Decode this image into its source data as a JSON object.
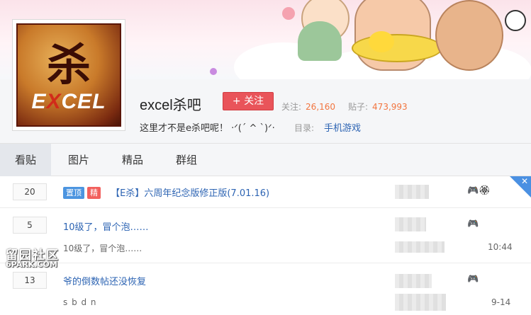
{
  "forum": {
    "name": "excel杀吧",
    "follow_label": "+ 关注",
    "followers_label": "关注:",
    "followers": "26,160",
    "posts_label": "贴子:",
    "posts": "473,993",
    "slogan": "这里才不是e杀吧呢！ ·ᐟ(´ ^ `)ᐟ·",
    "directory_label": "目录:",
    "directory": "手机游戏",
    "logo_text_top": "杀",
    "logo_text_bottom": "EXCEL"
  },
  "tabs": [
    {
      "label": "看贴",
      "active": true
    },
    {
      "label": "图片",
      "active": false
    },
    {
      "label": "精品",
      "active": false
    },
    {
      "label": "群组",
      "active": false
    }
  ],
  "threads": [
    {
      "replies": "20",
      "badges": [
        "置顶",
        "精"
      ],
      "title": "【E杀】六周年纪念版修正版(7.01.16)",
      "abstract": "",
      "time": ""
    },
    {
      "replies": "5",
      "badges": [],
      "title": "10级了，冒个泡……",
      "abstract": "10级了，冒个泡……",
      "time": "10:44"
    },
    {
      "replies": "13",
      "badges": [],
      "title": "爷的倒数帖还没恢复",
      "abstract": "s b d n",
      "time": "9-14"
    }
  ],
  "watermark": {
    "line1": "留园社区",
    "line2": "6PARK.COM"
  },
  "close_glyph": "✕"
}
